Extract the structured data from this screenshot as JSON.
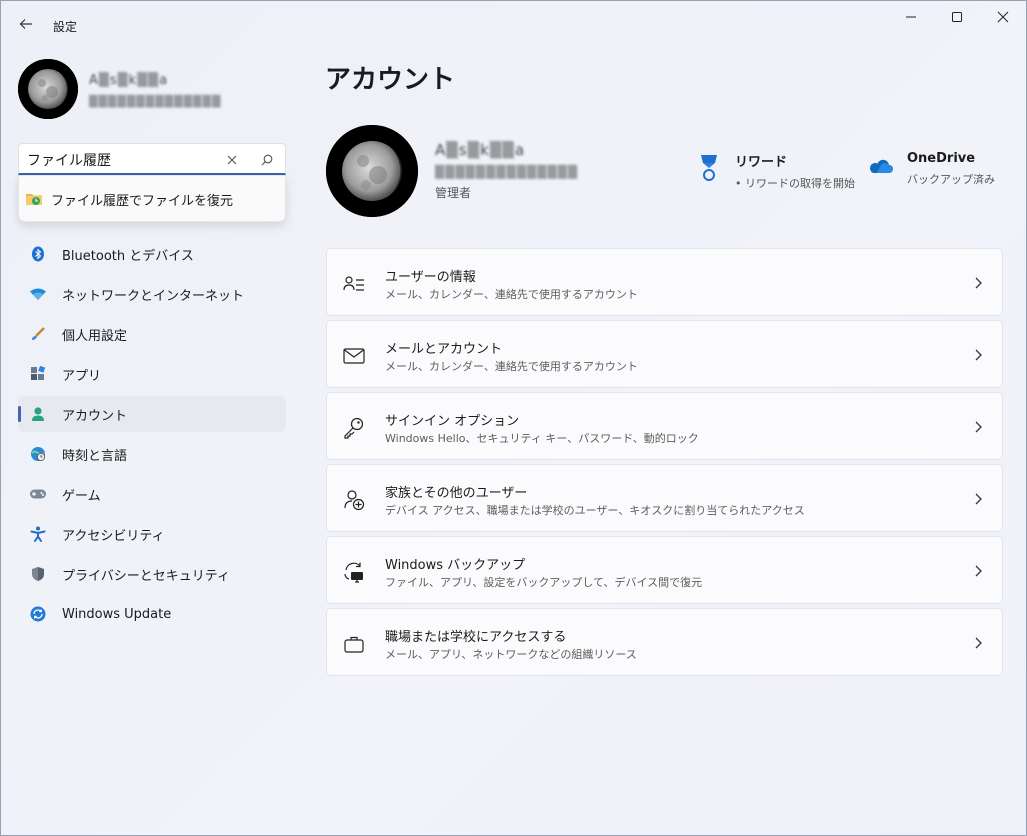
{
  "window": {
    "title": "設定"
  },
  "sidebar": {
    "user_name_blurred": "A▒s▒k▒▒a",
    "user_email_blurred": "▒▒▒▒▒▒▒▒▒▒▒▒▒▒",
    "search": {
      "value": "ファイル履歴",
      "placeholder": ""
    },
    "suggestion": {
      "label": "ファイル履歴でファイルを復元"
    },
    "items": [
      {
        "label": "Bluetooth とデバイス",
        "icon": "bluetooth-icon",
        "active": false
      },
      {
        "label": "ネットワークとインターネット",
        "icon": "wifi-icon",
        "active": false
      },
      {
        "label": "個人用設定",
        "icon": "brush-icon",
        "active": false
      },
      {
        "label": "アプリ",
        "icon": "apps-icon",
        "active": false
      },
      {
        "label": "アカウント",
        "icon": "account-icon",
        "active": true
      },
      {
        "label": "時刻と言語",
        "icon": "globe-clock-icon",
        "active": false
      },
      {
        "label": "ゲーム",
        "icon": "gamepad-icon",
        "active": false
      },
      {
        "label": "アクセシビリティ",
        "icon": "accessibility-icon",
        "active": false
      },
      {
        "label": "プライバシーとセキュリティ",
        "icon": "shield-icon",
        "active": false
      },
      {
        "label": "Windows Update",
        "icon": "update-icon",
        "active": false
      }
    ]
  },
  "main": {
    "title": "アカウント",
    "user": {
      "name_blurred": "A▒s▒k▒▒a",
      "email_blurred": "▒▒▒▒▒▒▒▒▒▒▒▒▒▒",
      "role": "管理者"
    },
    "rewards": {
      "title": "リワード",
      "sub": "• リワードの取得を開始"
    },
    "onedrive": {
      "title": "OneDrive",
      "sub": "バックアップ済み"
    },
    "cards": [
      {
        "title": "ユーザーの情報",
        "sub": "メール、カレンダー、連絡先で使用するアカウント",
        "icon": "user-info-icon"
      },
      {
        "title": "メールとアカウント",
        "sub": "メール、カレンダー、連絡先で使用するアカウント",
        "icon": "mail-icon"
      },
      {
        "title": "サインイン オプション",
        "sub": "Windows Hello、セキュリティ キー、パスワード、動的ロック",
        "icon": "key-icon"
      },
      {
        "title": "家族とその他のユーザー",
        "sub": "デバイス アクセス、職場または学校のユーザー、キオスクに割り当てられたアクセス",
        "icon": "add-user-icon"
      },
      {
        "title": "Windows バックアップ",
        "sub": "ファイル、アプリ、設定をバックアップして、デバイス間で復元",
        "icon": "backup-icon"
      },
      {
        "title": "職場または学校にアクセスする",
        "sub": "メール、アプリ、ネットワークなどの組織リソース",
        "icon": "briefcase-icon"
      }
    ]
  },
  "colors": {
    "accent": "#4a5fb5",
    "search_underline": "#3a62b0",
    "onedrive": "#0f6cbd"
  }
}
